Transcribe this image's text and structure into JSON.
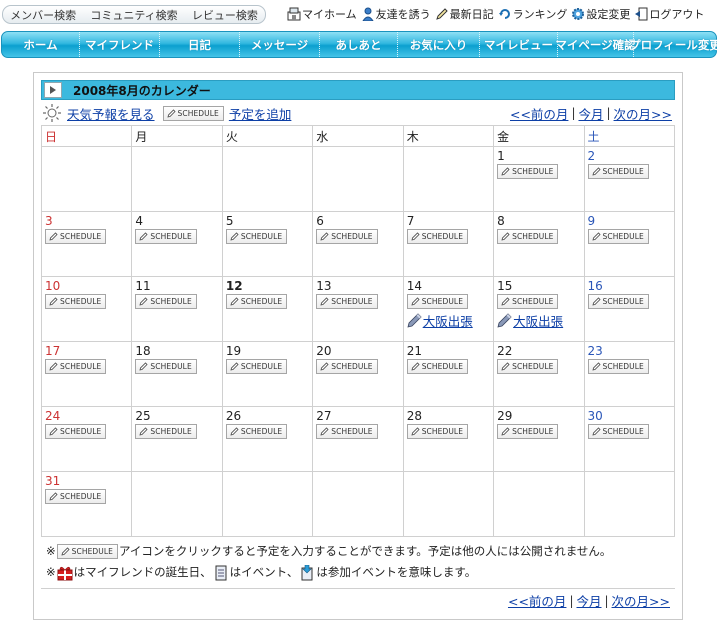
{
  "search_bar": {
    "member_search": "メンバー検索",
    "community_search": "コミュニティ検索",
    "review_search": "レビュー検索"
  },
  "utility_links": {
    "my_home": "マイホーム",
    "invite_friend": "友達を誘う",
    "latest_diary": "最新日記",
    "ranking": "ランキング",
    "settings": "設定変更",
    "logout": "ログアウト"
  },
  "nav": [
    "ホーム",
    "マイフレンド",
    "日記",
    "メッセージ",
    "あしあと",
    "お気に入り",
    "マイレビュー",
    "マイページ確認",
    "プロフィール変更"
  ],
  "calendar": {
    "title": "2008年8月のカレンダー",
    "weather_link": "天気予報を見る",
    "schedule_label": "SCHEDULE",
    "add_schedule": "予定を追加",
    "prev_month": "<<前の月",
    "this_month": "今月",
    "next_month": "次の月>>",
    "weekdays": [
      "日",
      "月",
      "火",
      "水",
      "木",
      "金",
      "土"
    ],
    "today": 12,
    "weeks": [
      [
        null,
        null,
        null,
        null,
        null,
        1,
        2
      ],
      [
        3,
        4,
        5,
        6,
        7,
        8,
        9
      ],
      [
        10,
        11,
        12,
        13,
        14,
        15,
        16
      ],
      [
        17,
        18,
        19,
        20,
        21,
        22,
        23
      ],
      [
        24,
        25,
        26,
        27,
        28,
        29,
        30
      ],
      [
        31,
        null,
        null,
        null,
        null,
        null,
        null
      ]
    ],
    "events": {
      "14": "大阪出張",
      "15": "大阪出張"
    }
  },
  "legend": {
    "line1_prefix": "※",
    "line1_text": "アイコンをクリックすると予定を入力することができます。予定は他の人には公開されません。",
    "line2_prefix": "※",
    "line2_birthday": "はマイフレンドの誕生日、",
    "line2_event": "はイベント、",
    "line2_joined": "は参加イベントを意味します。"
  },
  "colors": {
    "nav_blue": "#1fadd9",
    "header_blue": "#3cb9de",
    "link_blue": "#0d3fa6",
    "sunday_red": "#cc3333",
    "saturday_blue": "#2a56b8"
  }
}
